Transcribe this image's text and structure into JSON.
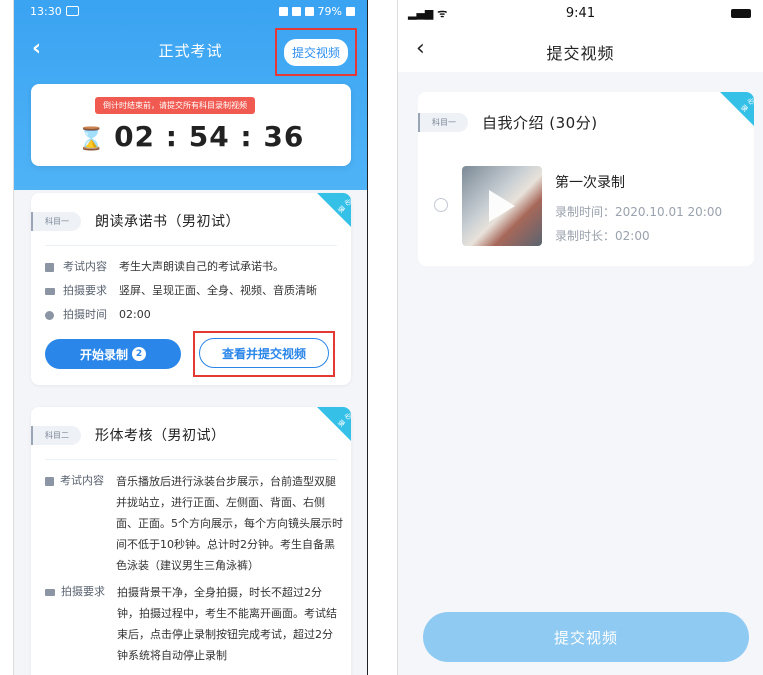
{
  "left": {
    "status": {
      "time": "13:30",
      "battery": "79%"
    },
    "nav": {
      "back": "‹",
      "title": "正式考试",
      "submit": "提交视频"
    },
    "timer": {
      "warning": "倒计时结束前，请提交所有科目录制视频",
      "hourglass": "⌛",
      "countdown": "02 : 54 : 36"
    },
    "required_tag": "必录",
    "card1": {
      "chip": "科目一",
      "title": "朗读承诺书（男初试）",
      "rows": [
        {
          "label": "考试内容",
          "value": "考生大声朗读自己的考试承诺书。"
        },
        {
          "label": "拍摄要求",
          "value": "竖屏、呈现正面、全身、视频、音质清晰"
        },
        {
          "label": "拍摄时间",
          "value": "02:00"
        }
      ],
      "start_button": "开始录制",
      "start_badge": "2",
      "view_button": "查看并提交视频"
    },
    "card2": {
      "chip": "科目二",
      "title": "形体考核（男初试）",
      "rows": [
        {
          "label": "考试内容",
          "value": "音乐播放后进行泳装台步展示，台前造型双腿并拢站立，进行正面、左侧面、背面、右侧面、正面。5个方向展示，每个方向镜头展示时间不低于10秒钟。总计时2分钟。考生自备黑色泳装（建议男生三角泳裤）"
        },
        {
          "label": "拍摄要求",
          "value": "拍摄背景干净，全身拍摄，时长不超过2分钟，拍摄过程中，考生不能离开画面。考试结束后，点击停止录制按钮完成考试，超过2分钟系统将自动停止录制"
        }
      ]
    }
  },
  "right": {
    "status": {
      "signal": "▂▄▆ ᯤ",
      "time": "9:41"
    },
    "nav": {
      "back": "‹",
      "title": "提交视频"
    },
    "required_tag": "必录",
    "card": {
      "chip": "科目一",
      "title": "自我介绍 (30分)",
      "recording": {
        "title": "第一次录制",
        "time": "录制时间：2020.10.01 20:00",
        "duration": "录制时长：02:00"
      }
    },
    "submit_button": "提交视频"
  }
}
